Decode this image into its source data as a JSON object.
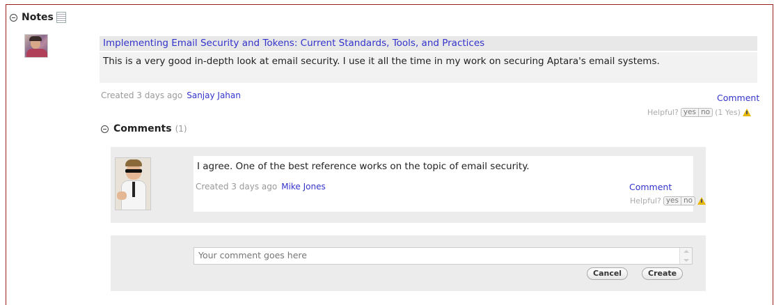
{
  "notes": {
    "title": "Notes",
    "collapse_icon": "circle-minus-icon",
    "doc_icon": "document-icon"
  },
  "note": {
    "title": "Implementing Email Security and Tokens: Current Standards, Tools, and Practices",
    "body": "This is a very good in-depth look at email security. I use it all the time in my work on securing Aptara's email systems.",
    "created": "Created 3 days ago",
    "author": "Sanjay Jahan",
    "comment_link": "Comment",
    "helpful_label": "Helpful?",
    "yes_label": "yes",
    "no_label": "no",
    "helpful_count": "(1 Yes)"
  },
  "comments": {
    "title": "Comments",
    "count": "(1)",
    "items": [
      {
        "text": "I agree. One of the best reference works on the topic of email security.",
        "created": "Created 3 days ago",
        "author": "Mike Jones",
        "comment_link": "Comment",
        "helpful_label": "Helpful?",
        "yes_label": "yes",
        "no_label": "no"
      }
    ]
  },
  "new_comment": {
    "placeholder": "Your comment goes here",
    "cancel_label": "Cancel",
    "create_label": "Create"
  },
  "colors": {
    "frame_border": "#9b1d1d",
    "link": "#3333cc",
    "warning": "#e6b800"
  }
}
